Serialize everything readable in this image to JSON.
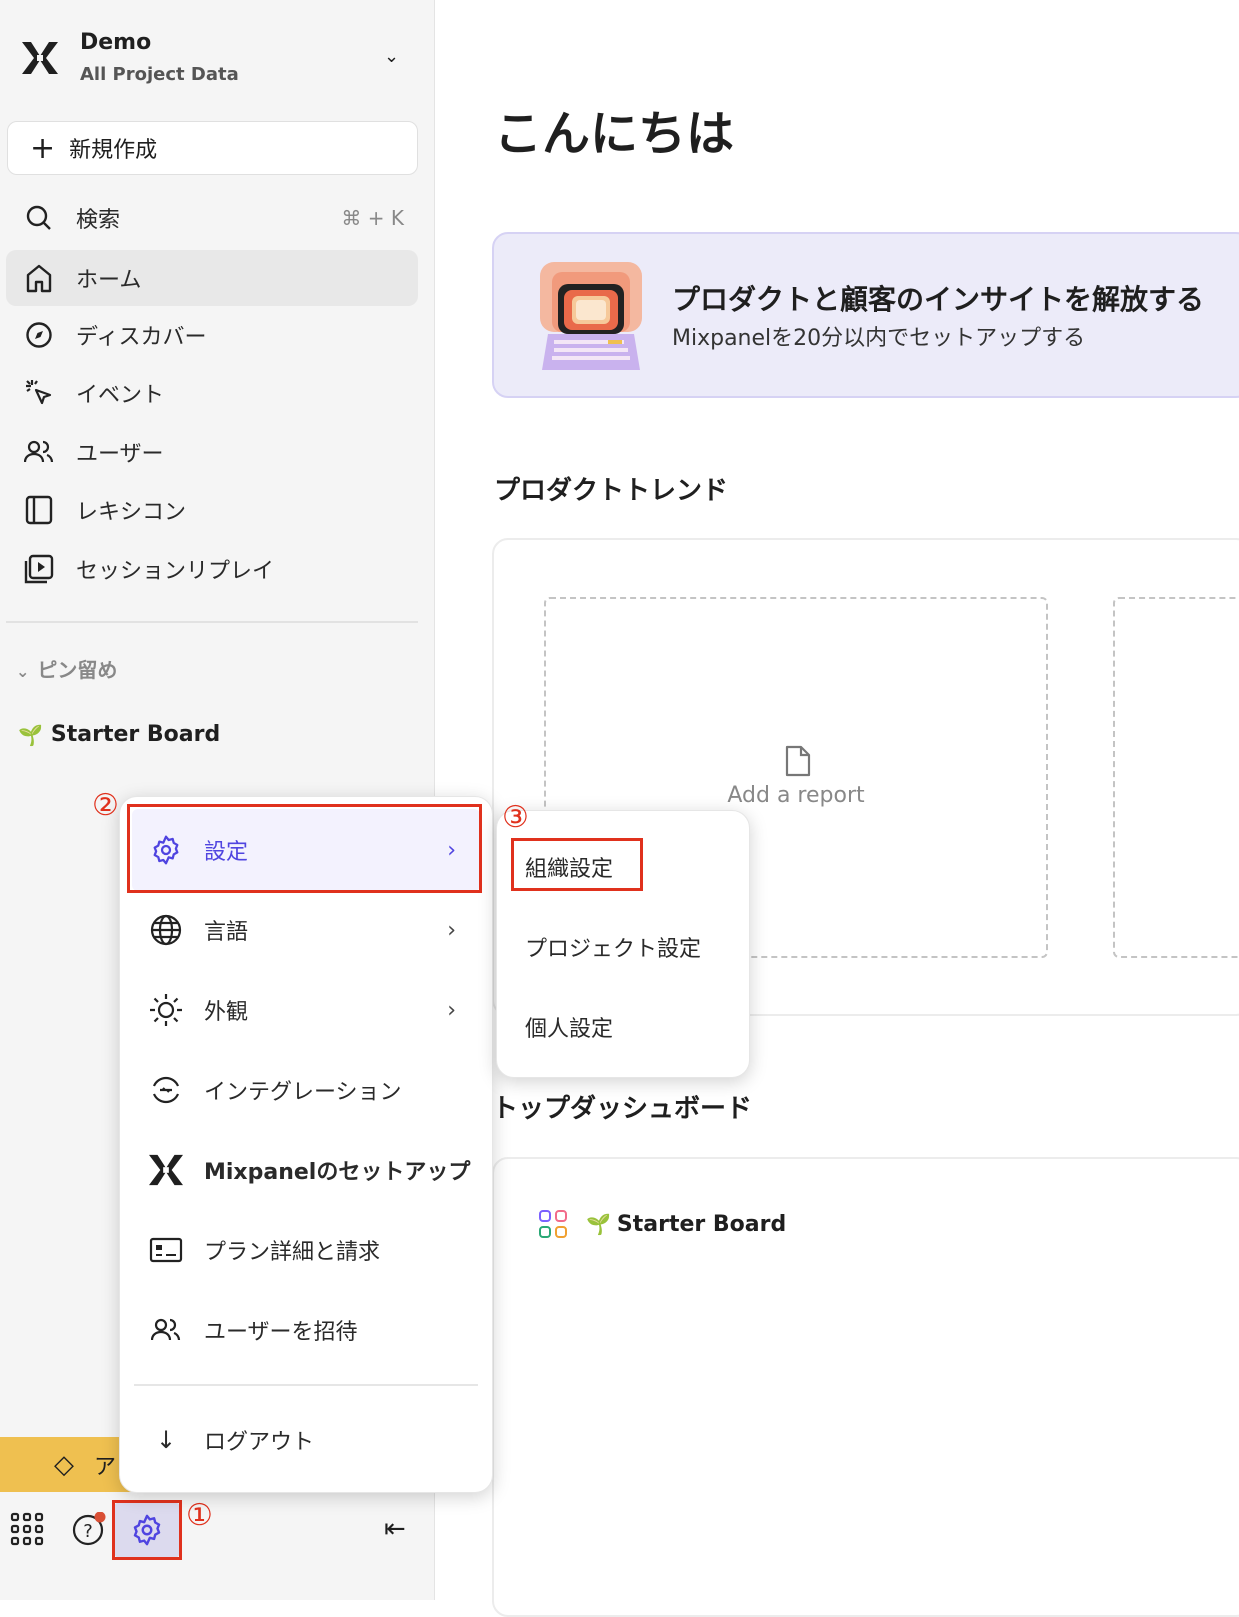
{
  "workspace": {
    "name": "Demo",
    "subtitle": "All Project Data"
  },
  "new_button": "新規作成",
  "search": {
    "label": "検索",
    "shortcut": "⌘ + K"
  },
  "nav": [
    {
      "label": "ホーム",
      "icon": "home-icon"
    },
    {
      "label": "ディスカバー",
      "icon": "compass-icon"
    },
    {
      "label": "イベント",
      "icon": "click-icon"
    },
    {
      "label": "ユーザー",
      "icon": "users-icon"
    },
    {
      "label": "レキシコン",
      "icon": "book-icon"
    },
    {
      "label": "セッションリプレイ",
      "icon": "replay-icon"
    }
  ],
  "pinned": {
    "header": "ピン留め",
    "items": [
      {
        "label": "Starter Board"
      }
    ]
  },
  "upgrade_label": "ア",
  "menu": {
    "items": [
      {
        "label": "設定",
        "icon": "gear-icon",
        "submenu": true
      },
      {
        "label": "言語",
        "icon": "globe-icon",
        "submenu": true
      },
      {
        "label": "外観",
        "icon": "sun-icon",
        "submenu": true
      },
      {
        "label": "インテグレーション",
        "icon": "integration-icon"
      },
      {
        "label": "Mixpanelのセットアップ",
        "icon": "mixpanel-logo-icon"
      },
      {
        "label": "プラン詳細と請求",
        "icon": "billing-icon"
      },
      {
        "label": "ユーザーを招待",
        "icon": "users-icon"
      }
    ],
    "logout": "ログアウト"
  },
  "submenu": [
    "組織設定",
    "プロジェクト設定",
    "個人設定"
  ],
  "annotations": [
    "①",
    "②",
    "③"
  ],
  "main": {
    "greeting": "こんにちは",
    "banner": {
      "title": "プロダクトと顧客のインサイトを解放する",
      "subtitle": "Mixpanelを20分以内でセットアップする"
    },
    "trends_title": "プロダクトトレンド",
    "add_report": "Add a report",
    "dashboards_title": "トップダッシュボード",
    "dashboard_item": "Starter Board"
  },
  "colors": {
    "accent": "#4f44e0",
    "annotation": "#e0311d",
    "upgrade": "#efc050",
    "banner": "#ecebf9"
  }
}
